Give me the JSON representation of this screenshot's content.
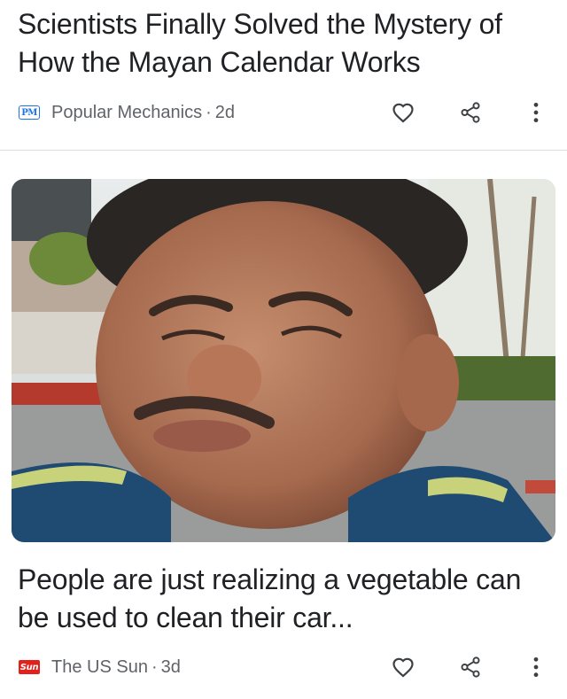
{
  "feed": {
    "articles": [
      {
        "headline": "Scientists Finally Solved the Mystery of How the Mayan Calendar Works",
        "logo_text": "PM",
        "logo_icon": "popular-mechanics-logo",
        "source": "Popular Mechanics",
        "separator": "·",
        "age": "2d",
        "has_image": false
      },
      {
        "headline": "People are just realizing a vegetable can be used to clean their car...",
        "logo_text": "Sun",
        "logo_icon": "the-us-sun-logo",
        "source": "The US Sun",
        "separator": "·",
        "age": "3d",
        "has_image": true
      }
    ],
    "icons": {
      "favorite": "heart-outline-icon",
      "share": "share-icon",
      "more": "more-vertical-icon"
    },
    "colors": {
      "headline": "#202124",
      "meta": "#5f6368",
      "pm_brand": "#1a73e8",
      "sun_brand": "#e2201c",
      "divider": "#dadce0"
    }
  }
}
